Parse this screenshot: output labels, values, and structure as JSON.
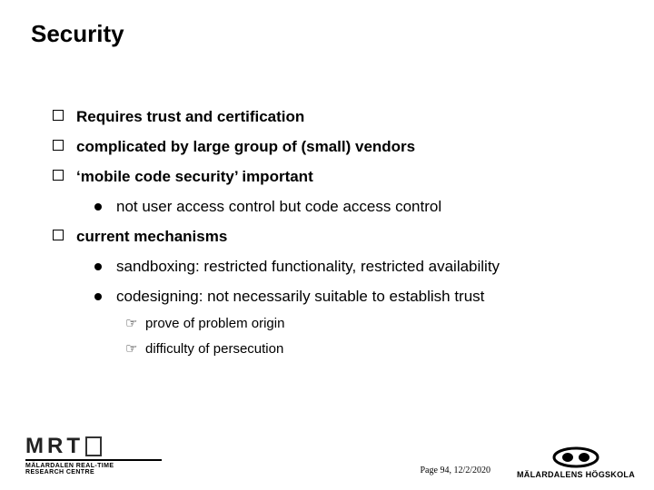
{
  "title": "Security",
  "bullets": {
    "b1": "Requires trust and certification",
    "b2": "complicated by large group of (small) vendors",
    "b3": "‘mobile code security’ important",
    "b3_1": "not user access control but code access control",
    "b4": "current mechanisms",
    "b4_1": "sandboxing: restricted functionality, restricted availability",
    "b4_2": "codesigning: not necessarily suitable to establish trust",
    "b4_2_a": "prove of problem origin",
    "b4_2_b": "difficulty of persecution"
  },
  "footer": {
    "page": "Page 94, 12/2/2020"
  },
  "logos": {
    "mrtc_name": "MRTC",
    "mrtc_sub1": "MÄLARDALEN REAL-TIME",
    "mrtc_sub2": "RESEARCH CENTRE",
    "mdh_name": "MÄLARDALENS HÖGSKOLA"
  }
}
